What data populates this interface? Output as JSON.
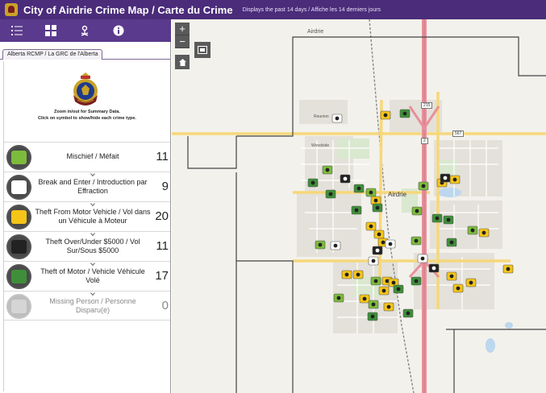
{
  "header": {
    "title": "City of Airdrie Crime Map / Carte du Crime",
    "subtitle": "Displays the past 14 days / Affiche les 14 derniers jours"
  },
  "toolbar": {
    "buttons": [
      {
        "name": "legend-list-button",
        "icon": "list-icon"
      },
      {
        "name": "grid-view-button",
        "icon": "grid-icon"
      },
      {
        "name": "location-pin-button",
        "icon": "map-pin-icon"
      },
      {
        "name": "info-button",
        "icon": "info-icon"
      }
    ]
  },
  "panel": {
    "tab_label": "Alberta RCMP / La GRC de l'Alberta",
    "instructions": "Zoom in/out for Summary Data.\nClick on symbol to show/hide each crime type."
  },
  "crimes": [
    {
      "label": "Mischief / Méfait",
      "count": "11",
      "color": "#7dbb3c",
      "icon": "mischief-icon",
      "enabled": true
    },
    {
      "label": "Break and Enter / Introduction par Effraction",
      "count": "9",
      "color": "#ffffff",
      "icon": "break-enter-icon",
      "enabled": true
    },
    {
      "label": "Theft From Motor Vehicle / Vol dans un Véhicule à Moteur",
      "count": "20",
      "color": "#f5c518",
      "icon": "theft-from-vehicle-icon",
      "enabled": true
    },
    {
      "label": "Theft Over/Under $5000 / Vol Sur/Sous $5000",
      "count": "11",
      "color": "#222222",
      "icon": "money-bag-icon",
      "enabled": true
    },
    {
      "label": "Theft of Motor / Vehicle Véhicule Volé",
      "count": "17",
      "color": "#3f8f3a",
      "icon": "stolen-car-icon",
      "enabled": true
    },
    {
      "label": "Missing Person / Personne Disparu(e)",
      "count": "0",
      "color": "#d5d5d5",
      "icon": "missing-person-icon",
      "enabled": false
    }
  ],
  "map": {
    "labels": {
      "town_north": "Airdrie",
      "city": "Airdrie",
      "district_1": "Reunion",
      "district_2": "Woodside",
      "road_567": "567",
      "road_2": "2",
      "road_215": "215"
    },
    "zoom_in": "+",
    "zoom_out": "−"
  },
  "colors": {
    "header_bg": "#4a2c7a",
    "toolbar_bg": "#5a3a8c",
    "highway": "#e8909c",
    "major_road": "#f6d77a"
  }
}
